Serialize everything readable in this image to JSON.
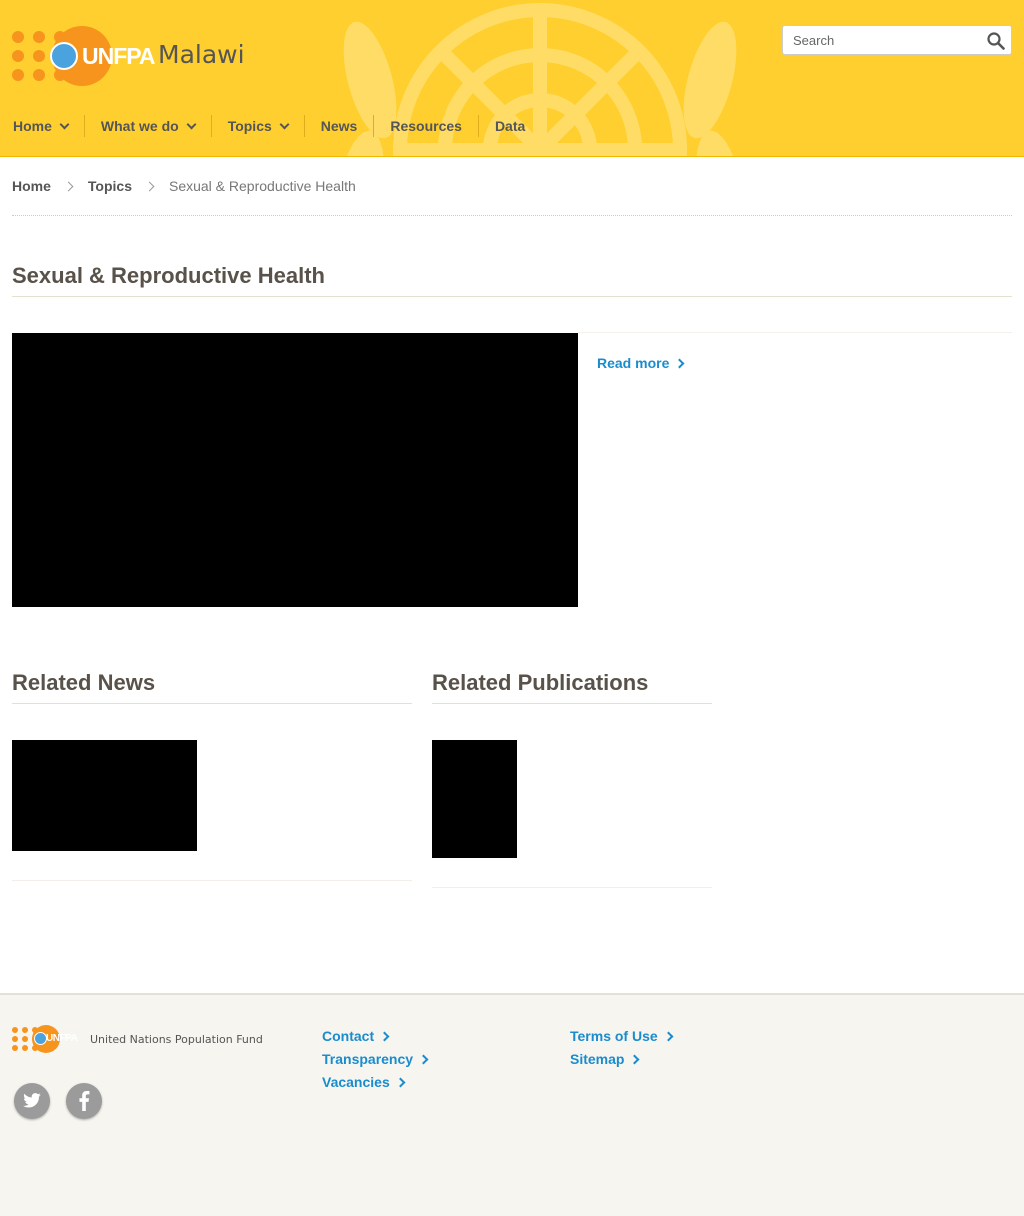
{
  "brand": {
    "logo_text": "UNFPA",
    "country": "Malawi",
    "accent": "#ffcf30",
    "orange": "#f7941d",
    "link_color": "#1a8ccd"
  },
  "search": {
    "placeholder": "Search",
    "icon": "search-icon"
  },
  "nav": {
    "items": [
      {
        "label": "Home",
        "dropdown": true
      },
      {
        "label": "What we do",
        "dropdown": true
      },
      {
        "label": "Topics",
        "dropdown": true
      },
      {
        "label": "News",
        "dropdown": false
      },
      {
        "label": "Resources",
        "dropdown": false
      },
      {
        "label": "Data",
        "dropdown": false
      }
    ]
  },
  "breadcrumb": {
    "items": [
      "Home",
      "Topics"
    ],
    "current": "Sexual & Reproductive Health"
  },
  "main": {
    "title": "Sexual & Reproductive Health",
    "read_more": "Read more"
  },
  "related_news": {
    "title": "Related News"
  },
  "related_publications": {
    "title": "Related Publications"
  },
  "footer": {
    "org_name": "United Nations Population Fund",
    "logo_text": "UNFPA",
    "social": [
      "twitter-icon",
      "facebook-icon"
    ],
    "links_col1": [
      "Contact",
      "Transparency",
      "Vacancies"
    ],
    "links_col2": [
      "Terms of Use",
      "Sitemap"
    ]
  }
}
